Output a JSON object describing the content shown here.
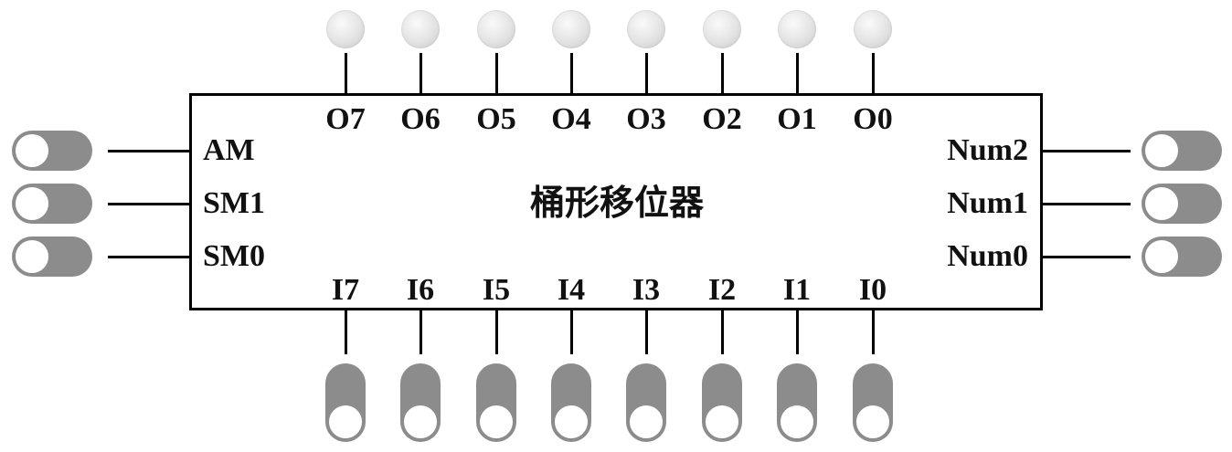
{
  "title": "桶形移位器",
  "outputs": [
    "O7",
    "O6",
    "O5",
    "O4",
    "O3",
    "O2",
    "O1",
    "O0"
  ],
  "inputs": [
    "I7",
    "I6",
    "I5",
    "I4",
    "I3",
    "I2",
    "I1",
    "I0"
  ],
  "left_controls": [
    "AM",
    "SM1",
    "SM0"
  ],
  "right_controls": [
    "Num2",
    "Num1",
    "Num0"
  ],
  "colors": {
    "switch": "#8c8c8c",
    "led": "#e3e3e3",
    "wire": "#000000"
  }
}
